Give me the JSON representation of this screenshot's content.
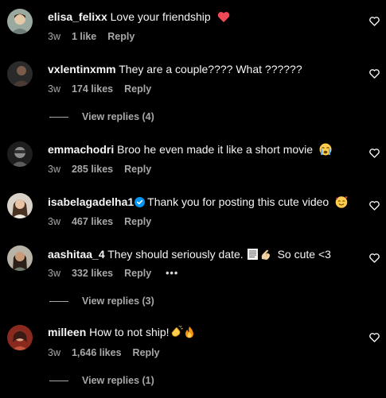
{
  "comments": [
    {
      "username": "elisa_felixx",
      "text": "Love your friendship",
      "time": "3w",
      "likes": "1 like",
      "reply": "Reply"
    },
    {
      "username": "vxlentinxmm",
      "text": "They are a couple???? What ??????",
      "time": "3w",
      "likes": "174 likes",
      "reply": "Reply",
      "view_replies": "View replies (4)"
    },
    {
      "username": "emmachodri",
      "text": "Broo he even made it like a short movie",
      "time": "3w",
      "likes": "285 likes",
      "reply": "Reply"
    },
    {
      "username": "isabelagadelha1",
      "text": "Thank you for posting this cute video",
      "time": "3w",
      "likes": "467 likes",
      "reply": "Reply"
    },
    {
      "username": "aashitaa_4",
      "text": "They should seriously date.",
      "text_after": "So cute <3",
      "time": "3w",
      "likes": "332 likes",
      "reply": "Reply",
      "more": "•••",
      "view_replies": "View replies (3)"
    },
    {
      "username": "milleen",
      "text": "How to not ship!",
      "time": "3w",
      "likes": "1,646 likes",
      "reply": "Reply",
      "view_replies": "View replies (1)"
    }
  ],
  "icons": {
    "like": "heart-outline-icon",
    "verified": "verified-badge-icon",
    "more": "more-options-icon"
  },
  "colors": {
    "background": "#000000",
    "text": "#f5f5f5",
    "secondary": "#a8a8a8",
    "verified": "#0095f6",
    "heart_emoji": "#ed4956"
  }
}
